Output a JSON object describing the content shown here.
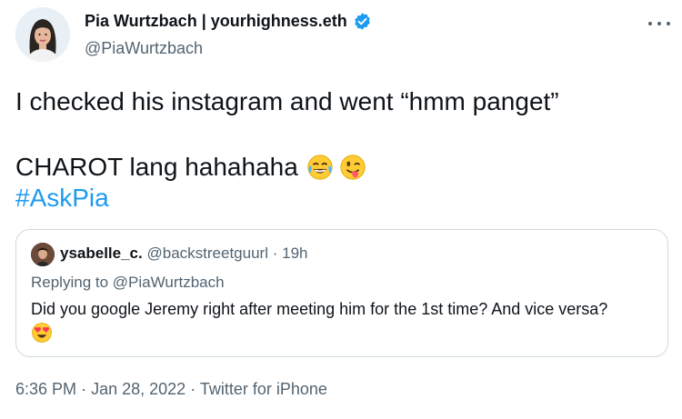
{
  "author": {
    "display_name": "Pia Wurtzbach | yourhighness.eth",
    "handle": "@PiaWurtzbach",
    "verified": true
  },
  "tweet": {
    "line1": "I checked his instagram and went “hmm panget”",
    "line2": "CHAROT lang hahahaha",
    "line2_emojis": [
      "face-with-tears-of-joy-emoji",
      "winking-face-with-tongue-emoji"
    ],
    "hashtag": "#AskPia"
  },
  "quote": {
    "name": "ysabelle_c.",
    "handle": "@backstreetguurl",
    "separator": "·",
    "time": "19h",
    "replying_prefix": "Replying to",
    "replying_to": "@PiaWurtzbach",
    "text": "Did you google Jeremy right after meeting him for the 1st time? And vice versa?",
    "emoji": "smiling-face-with-heart-eyes-emoji"
  },
  "footer": {
    "time": "6:36 PM",
    "sep1": "·",
    "date": "Jan 28, 2022",
    "sep2": "·",
    "source": "Twitter for iPhone"
  },
  "colors": {
    "text": "#0f1419",
    "muted": "#536471",
    "link": "#1d9bf0",
    "border": "#cfd9de",
    "verified_badge": "#1d9bf0"
  }
}
